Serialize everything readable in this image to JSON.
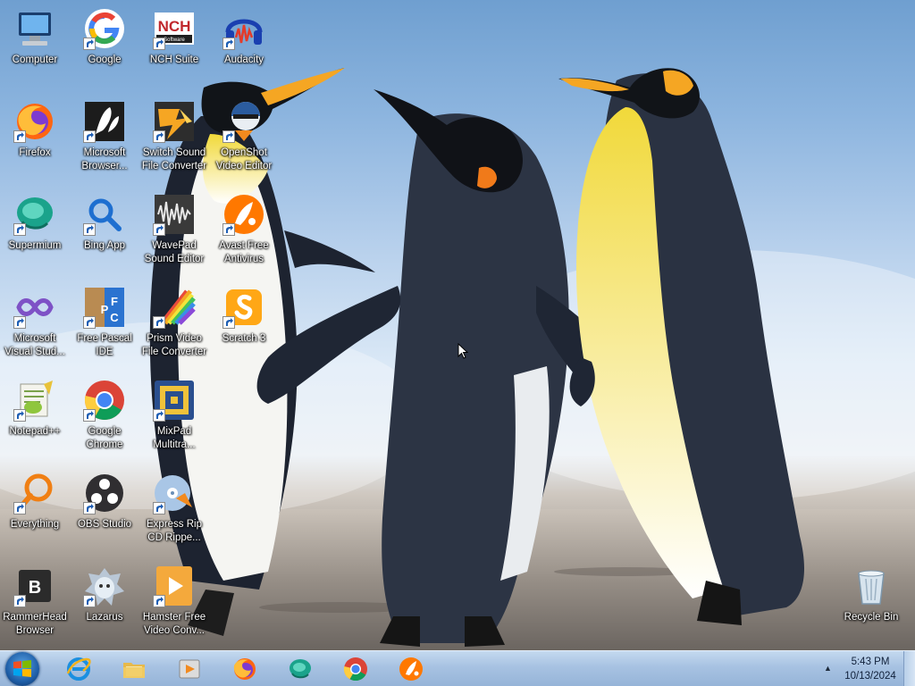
{
  "desktop": {
    "icons": [
      {
        "id": "computer",
        "label": "Computer",
        "icon": "computer-icon",
        "shortcut": false
      },
      {
        "id": "google",
        "label": "Google",
        "icon": "google-icon",
        "shortcut": true
      },
      {
        "id": "nch-suite",
        "label": "NCH Suite",
        "icon": "nch-suite-icon",
        "shortcut": true
      },
      {
        "id": "audacity",
        "label": "Audacity",
        "icon": "audacity-icon",
        "shortcut": true
      },
      {
        "id": "firefox",
        "label": "Firefox",
        "icon": "firefox-icon",
        "shortcut": true
      },
      {
        "id": "ms-browser",
        "label": "Microsoft\nBrowser...",
        "icon": "microsoft-browser-icon",
        "shortcut": true
      },
      {
        "id": "switch",
        "label": "Switch Sound\nFile Converter",
        "icon": "switch-sound-icon",
        "shortcut": true
      },
      {
        "id": "openshot",
        "label": "OpenShot\nVideo Editor",
        "icon": "openshot-icon",
        "shortcut": true
      },
      {
        "id": "supermium",
        "label": "Supermium",
        "icon": "supermium-icon",
        "shortcut": true
      },
      {
        "id": "bing",
        "label": "Bing App",
        "icon": "bing-search-icon",
        "shortcut": true
      },
      {
        "id": "wavepad",
        "label": "WavePad\nSound Editor",
        "icon": "wavepad-icon",
        "shortcut": true
      },
      {
        "id": "avast",
        "label": "Avast Free\nAntivirus",
        "icon": "avast-icon",
        "shortcut": true
      },
      {
        "id": "vs",
        "label": "Microsoft\nVisual Stud...",
        "icon": "visual-studio-icon",
        "shortcut": true
      },
      {
        "id": "fpc",
        "label": "Free Pascal\nIDE",
        "icon": "free-pascal-icon",
        "shortcut": true
      },
      {
        "id": "prism",
        "label": "Prism Video\nFile Converter",
        "icon": "prism-video-icon",
        "shortcut": true
      },
      {
        "id": "scratch",
        "label": "Scratch 3",
        "icon": "scratch-icon",
        "shortcut": true
      },
      {
        "id": "notepadpp",
        "label": "Notepad++",
        "icon": "notepadpp-icon",
        "shortcut": true
      },
      {
        "id": "chrome",
        "label": "Google\nChrome",
        "icon": "chrome-icon",
        "shortcut": true
      },
      {
        "id": "mixpad",
        "label": "MixPad\nMultitra...",
        "icon": "mixpad-icon",
        "shortcut": true
      },
      {
        "id": "everything",
        "label": "Everything",
        "icon": "everything-search-icon",
        "shortcut": true
      },
      {
        "id": "obs",
        "label": "OBS Studio",
        "icon": "obs-icon",
        "shortcut": true
      },
      {
        "id": "expressrip",
        "label": "Express Rip\nCD Rippe...",
        "icon": "express-rip-icon",
        "shortcut": true
      },
      {
        "id": "rammerhead",
        "label": "RammerHead\nBrowser",
        "icon": "rammerhead-icon",
        "shortcut": true
      },
      {
        "id": "lazarus",
        "label": "Lazarus",
        "icon": "lazarus-icon",
        "shortcut": true
      },
      {
        "id": "hamster",
        "label": "Hamster Free\nVideo Conv...",
        "icon": "hamster-icon",
        "shortcut": true
      },
      {
        "id": "recycle",
        "label": "Recycle Bin",
        "icon": "recycle-bin-icon",
        "shortcut": false
      }
    ]
  },
  "taskbar": {
    "start_icon": "windows-logo-icon",
    "apps": [
      {
        "id": "ie",
        "icon": "internet-explorer-icon"
      },
      {
        "id": "explorer",
        "icon": "file-explorer-icon"
      },
      {
        "id": "media",
        "icon": "media-player-icon"
      },
      {
        "id": "firefox",
        "icon": "firefox-icon"
      },
      {
        "id": "supermium",
        "icon": "supermium-icon"
      },
      {
        "id": "chrome",
        "icon": "chrome-icon"
      },
      {
        "id": "avast",
        "icon": "avast-icon"
      }
    ],
    "clock_time": "5:43 PM",
    "clock_date": "10/13/2024"
  }
}
